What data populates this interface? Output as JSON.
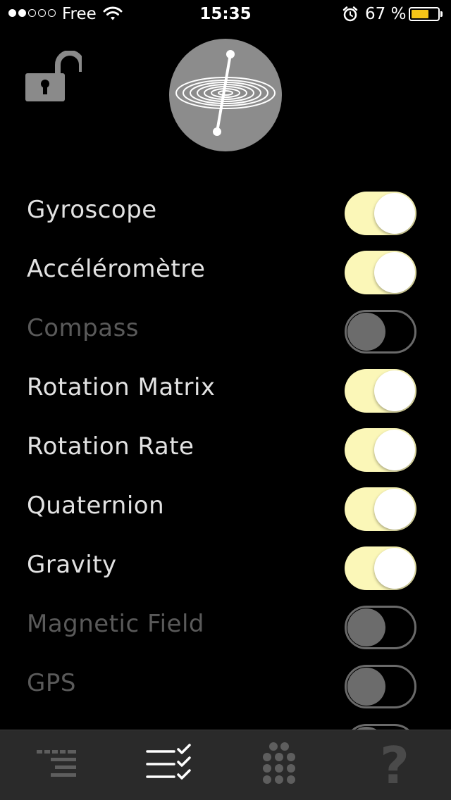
{
  "status_bar": {
    "carrier": "Free",
    "time": "15:35",
    "battery_percent": "67 %",
    "battery_level": 0.67,
    "signal_bars_filled": 2,
    "signal_bars_total": 5,
    "icons": [
      "wifi-icon",
      "alarm-icon",
      "battery-icon"
    ]
  },
  "header": {
    "lock_icon": "unlocked-padlock-icon",
    "logo_icon": "gyroscope-spiral-logo"
  },
  "sensors": [
    {
      "label": "Gyroscope",
      "enabled": true
    },
    {
      "label": "Accéléromètre",
      "enabled": true
    },
    {
      "label": "Compass",
      "enabled": false
    },
    {
      "label": "Rotation Matrix",
      "enabled": true
    },
    {
      "label": "Rotation Rate",
      "enabled": true
    },
    {
      "label": "Quaternion",
      "enabled": true
    },
    {
      "label": "Gravity",
      "enabled": true
    },
    {
      "label": "Magnetic Field",
      "enabled": false
    },
    {
      "label": "GPS",
      "enabled": false
    },
    {
      "label": "",
      "enabled": false
    }
  ],
  "tab_bar": {
    "tabs": [
      {
        "icon": "dashboard-lines-icon",
        "selected": false
      },
      {
        "icon": "checklist-icon",
        "selected": true
      },
      {
        "icon": "dots-grid-icon",
        "selected": false
      },
      {
        "icon": "help-question-icon",
        "glyph": "?",
        "selected": false
      }
    ]
  },
  "colors": {
    "background": "#000000",
    "toggle_on": "#fbf7b8",
    "toggle_off_knob": "#6c6c6c",
    "label_on": "#e2e2e2",
    "label_off": "#5a5a5a",
    "tab_bar_bg": "#2a2a2a",
    "battery_fill": "#f5c518"
  }
}
